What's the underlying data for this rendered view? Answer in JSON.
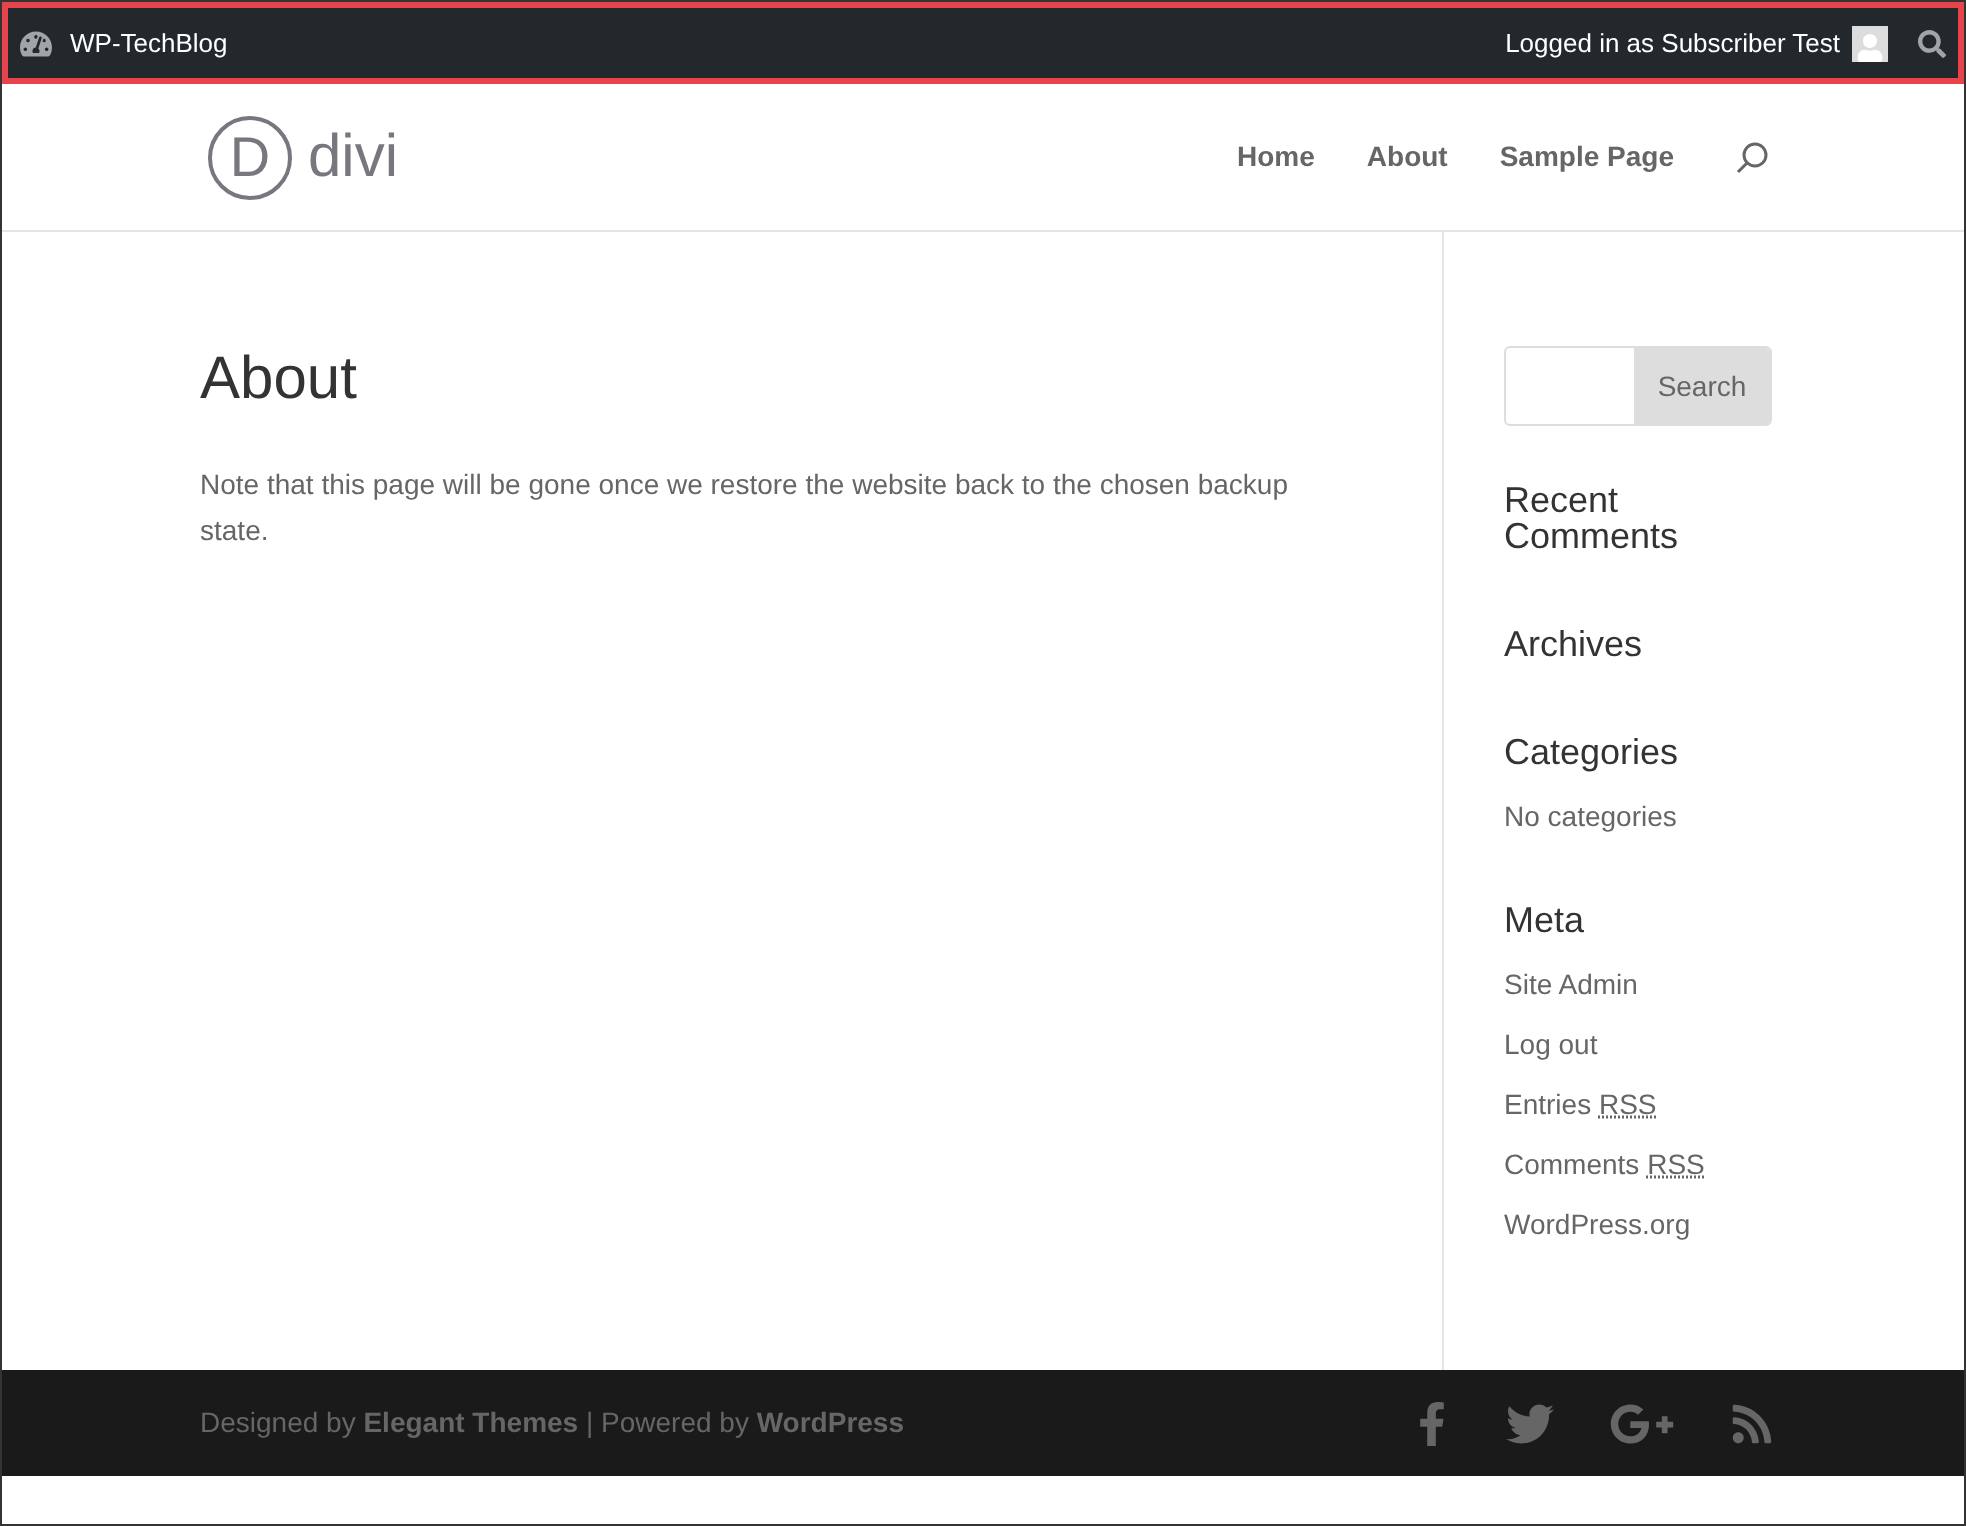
{
  "admin_bar": {
    "site_name": "WP-TechBlog",
    "account": "Logged in as Subscriber Test"
  },
  "header": {
    "logo": {
      "initial": "D",
      "name": "divi"
    },
    "nav": [
      "Home",
      "About",
      "Sample Page"
    ]
  },
  "page": {
    "title": "About",
    "body": "Note that this page will be gone once we restore the website back to the chosen backup state."
  },
  "sidebar": {
    "search_button": "Search",
    "widgets": [
      {
        "title": "Recent Comments"
      },
      {
        "title": "Archives"
      },
      {
        "title": "Categories",
        "texts": [
          "No categories"
        ]
      },
      {
        "title": "Meta",
        "links": [
          {
            "label": "Site Admin"
          },
          {
            "label": "Log out"
          },
          {
            "label": "Entries",
            "abbr": "RSS"
          },
          {
            "label": "Comments",
            "abbr": "RSS"
          },
          {
            "label": "WordPress.org"
          }
        ]
      }
    ]
  },
  "footer": {
    "credits": "Designed by **Elegant Themes** | Powered by **WordPress**"
  }
}
